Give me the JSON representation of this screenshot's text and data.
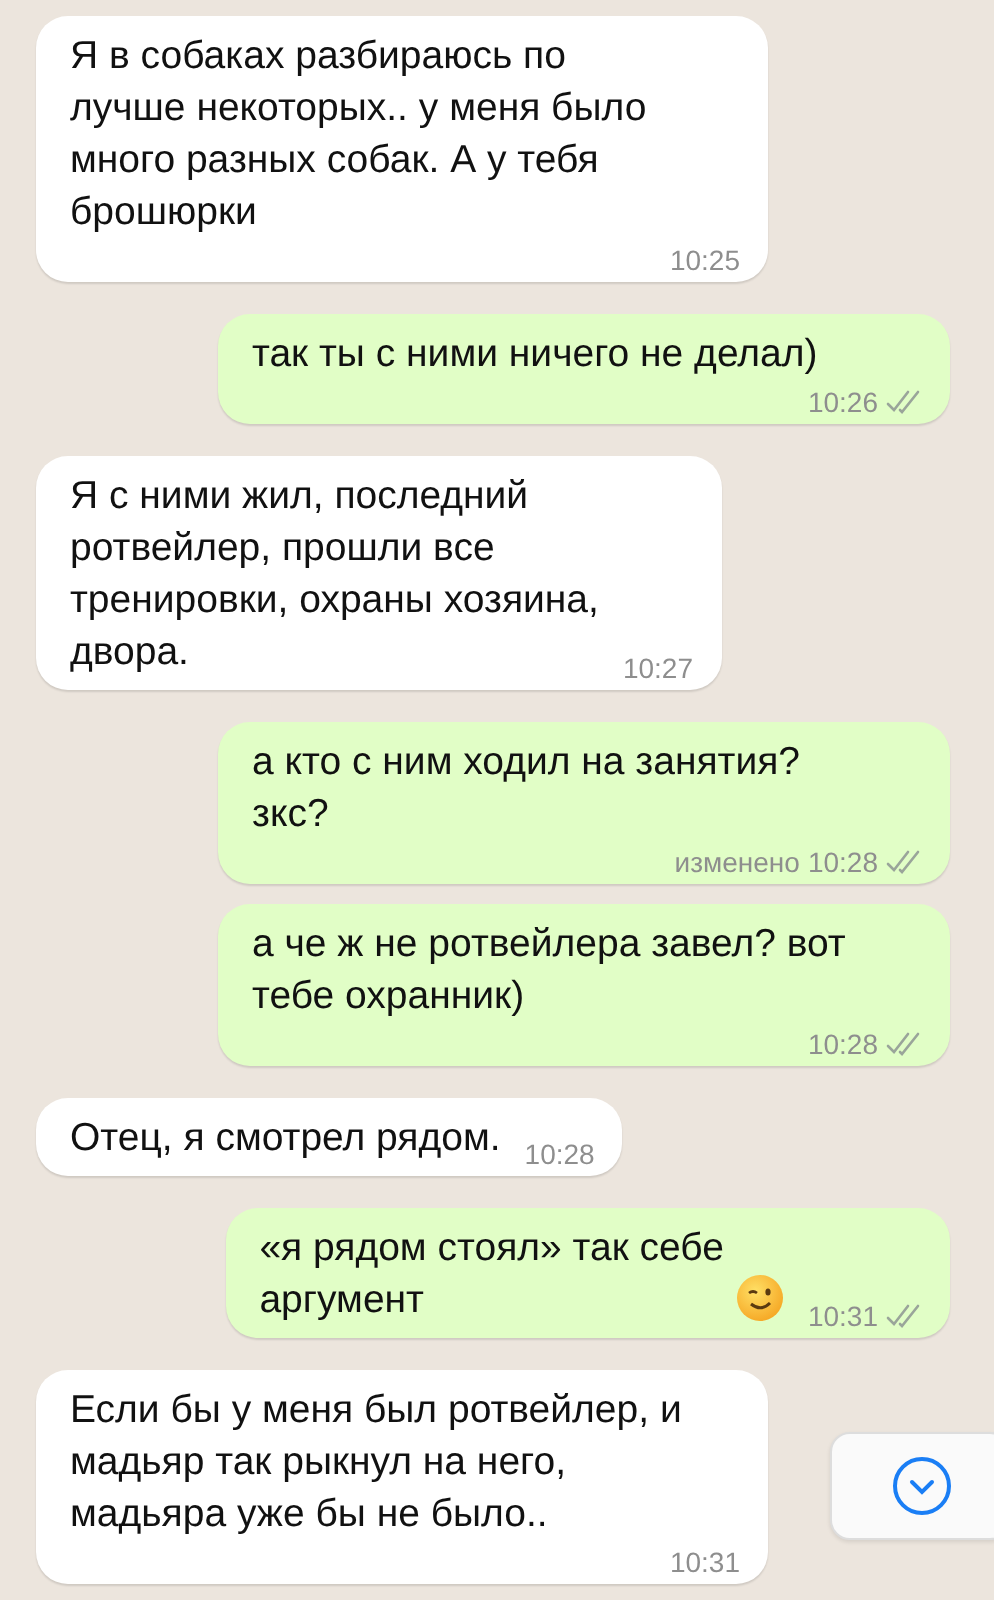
{
  "messages": [
    {
      "kind": "incoming",
      "text": "Я в собаках разбираюсь по\nлучше некоторых.. у меня было\nмного разных собак. А у тебя\nброшюрки",
      "time": "10:25"
    },
    {
      "kind": "outgoing",
      "text": "так ты с ними ничего не делал)",
      "time": "10:26",
      "read": false
    },
    {
      "kind": "incoming",
      "text": "Я с ними жил, последний\nротвейлер, прошли все\nтренировки, охраны хозяина,\nдвора.",
      "time": "10:27"
    },
    {
      "kind": "outgoing",
      "text": "а кто с ним ходил на занятия?\nзкс?",
      "edited_label": "изменено",
      "time": "10:28",
      "read": false
    },
    {
      "kind": "outgoing",
      "text": "а че ж не ротвейлера завел? вот\nтебе охранник)",
      "time": "10:28",
      "read": false
    },
    {
      "kind": "incoming",
      "text": "Отец, я смотрел рядом.",
      "time": "10:28"
    },
    {
      "kind": "outgoing",
      "text": "«я рядом стоял» так себе\nаргумент",
      "has_emoji": true,
      "time": "10:31",
      "read": false
    },
    {
      "kind": "incoming",
      "text": "Если бы у меня был ротвейлер, и\nмадьяр так рыкнул на него,\nмадьяра уже бы не было..",
      "time": "10:31"
    }
  ]
}
